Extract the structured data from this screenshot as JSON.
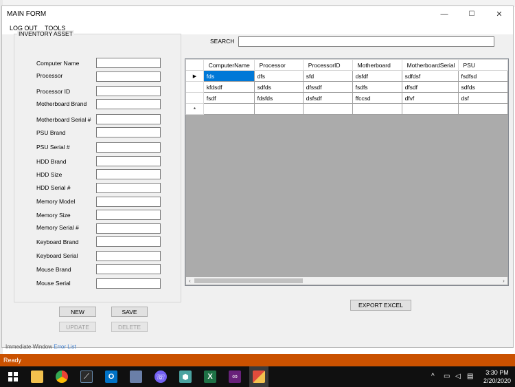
{
  "window": {
    "title": "MAIN FORM",
    "minimize": "—",
    "maximize": "☐",
    "close": "✕"
  },
  "menu": {
    "items": [
      "LOG OUT",
      "TOOLS"
    ]
  },
  "inventory": {
    "title": "INVENTORY ASSET",
    "fields": [
      "Computer Name",
      "Processor",
      "Processor ID",
      "Motherboard Brand",
      "Motherboard Serial #",
      "PSU Brand",
      "PSU Serial #",
      "HDD Brand",
      "HDD Size",
      "HDD Serial #",
      "Memory Model",
      "Memory Size",
      "Memory Serial #",
      "Keyboard Brand",
      "Keyboard Serial",
      "Mouse Brand",
      "Mouse Serial"
    ]
  },
  "buttons": {
    "new": "NEW",
    "save": "SAVE",
    "update": "UPDATE",
    "delete": "DELETE",
    "export": "EXPORT EXCEL"
  },
  "search": {
    "label": "SEARCH",
    "value": ""
  },
  "grid": {
    "columns": [
      "ComputerName",
      "Processor",
      "ProcessorID",
      "Motherboard",
      "MotherboardSerial",
      "PSU"
    ],
    "rows": [
      [
        "fds",
        "dfs",
        "sfd",
        "dsfdf",
        "sdfdsf",
        "fsdfsd"
      ],
      [
        "kfdsdf",
        "sdfds",
        "dfssdf",
        "fsdfs",
        "dfsdf",
        "sdfds"
      ],
      [
        "fsdf",
        "fdsfds",
        "dsfsdf",
        "ffccsd",
        "dfvf",
        "dsf"
      ]
    ],
    "current_row_marker": "▶",
    "new_row_marker": "*"
  },
  "background_panel": {
    "text_a": "Immediate Window",
    "text_b": "Error List"
  },
  "status_bar": {
    "text": "Ready",
    "color": "#ca5100"
  },
  "taskbar": {
    "icons": [
      "windows-start-icon",
      "search-icon",
      "file-explorer-icon",
      "chrome-icon",
      "code-editor-icon",
      "outlook-icon",
      "app-icon",
      "viber-icon",
      "cube-app-icon",
      "excel-icon",
      "visual-studio-icon",
      "running-app-icon"
    ],
    "tray": {
      "time": "3:30 PM",
      "date": "2/20/2020"
    }
  }
}
